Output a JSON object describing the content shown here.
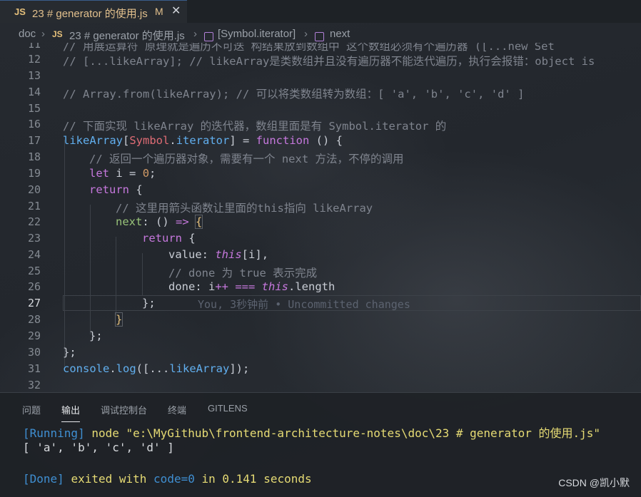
{
  "tab": {
    "icon_label": "JS",
    "title": "23 # generator 的使用.js",
    "modified_marker": "M",
    "close_glyph": "✕"
  },
  "breadcrumb": {
    "items": [
      "doc",
      "23 # generator 的使用.js",
      "[Symbol.iterator]",
      "next"
    ],
    "file_icon_label": "JS"
  },
  "editor": {
    "partial_top_line": "// 用展运算符 原理就是遍历不可迭 构结果放到数组中 这个数组必须有个遍历器 ([...new Set",
    "lines": [
      {
        "n": "11"
      },
      {
        "n": "12"
      },
      {
        "n": "13"
      },
      {
        "n": "14"
      },
      {
        "n": "15"
      },
      {
        "n": "16"
      },
      {
        "n": "17"
      },
      {
        "n": "18"
      },
      {
        "n": "19"
      },
      {
        "n": "20"
      },
      {
        "n": "21"
      },
      {
        "n": "22"
      },
      {
        "n": "23"
      },
      {
        "n": "24"
      },
      {
        "n": "25"
      },
      {
        "n": "26"
      },
      {
        "n": "27"
      },
      {
        "n": "28"
      },
      {
        "n": "29"
      },
      {
        "n": "30"
      },
      {
        "n": "31"
      },
      {
        "n": "32"
      }
    ],
    "code": {
      "l12": "// [...likeArray]; // likeArray是类数组并且没有遍历器不能迭代遍历，执行会报错：object is",
      "l14": "// Array.from(likeArray); // 可以将类数组转为数组：[ 'a', 'b', 'c', 'd' ]",
      "l16": "// 下面实现 likeArray 的迭代器，数组里面是有 Symbol.iterator 的",
      "l17_obj": "likeArray",
      "l17_sym": "Symbol",
      "l17_iter": "iterator",
      "l17_fn": "function",
      "l18": "// 返回一个遍历器对象，需要有一个 next 方法，不停的调用",
      "l19_kw": "let",
      "l19_var": "i",
      "l19_num": "0",
      "l20_kw": "return",
      "l21": "// 这里用箭头函数让里面的this指向 likeArray",
      "l22_prop": "next",
      "l23_kw": "return",
      "l24_prop": "value",
      "l24_this": "this",
      "l24_i": "i",
      "l25": "// done 为 true 表示完成",
      "l26_prop": "done",
      "l26_i": "i",
      "l26_this": "this",
      "l26_len": "length",
      "l31_console": "console",
      "l31_log": "log",
      "l31_arg": "likeArray"
    },
    "blame": "You, 3秒钟前 • Uncommitted changes"
  },
  "panel": {
    "tabs": [
      "问题",
      "输出",
      "调试控制台",
      "终端",
      "GITLENS"
    ],
    "active_tab": "输出",
    "output": {
      "running_tag": "[Running]",
      "running_cmd": "node \"e:\\MyGithub\\frontend-architecture-notes\\doc\\23 # generator 的使用.js\"",
      "result": "[ 'a', 'b', 'c', 'd' ]",
      "done_tag": "[Done]",
      "done_text1": "exited with",
      "done_code": "code=0",
      "done_text2": "in",
      "done_time": "0.141",
      "done_text3": "seconds"
    }
  },
  "watermark": "CSDN @凯小默"
}
